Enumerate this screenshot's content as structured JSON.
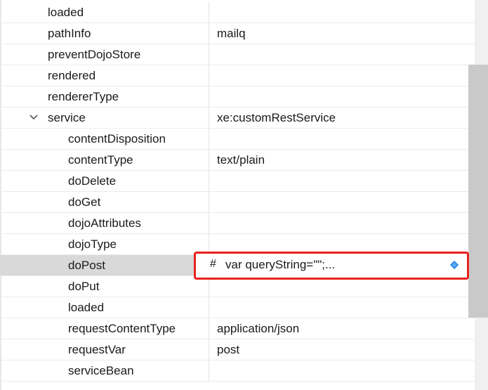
{
  "properties": [
    {
      "name": "loaded",
      "value": ""
    },
    {
      "name": "pathInfo",
      "value": "mailq"
    },
    {
      "name": "preventDojoStore",
      "value": ""
    },
    {
      "name": "rendered",
      "value": ""
    },
    {
      "name": "rendererType",
      "value": ""
    },
    {
      "name": "service",
      "value": "xe:customRestService",
      "expanded": true
    },
    {
      "name": "contentDisposition",
      "value": ""
    },
    {
      "name": "contentType",
      "value": "text/plain"
    },
    {
      "name": "doDelete",
      "value": ""
    },
    {
      "name": "doGet",
      "value": ""
    },
    {
      "name": "dojoAttributes",
      "value": ""
    },
    {
      "name": "dojoType",
      "value": ""
    },
    {
      "name": "doPost",
      "value": "",
      "selected": true
    },
    {
      "name": "doPut",
      "value": ""
    },
    {
      "name": "loaded",
      "value": ""
    },
    {
      "name": "requestContentType",
      "value": "application/json"
    },
    {
      "name": "requestVar",
      "value": "post"
    },
    {
      "name": "serviceBean",
      "value": ""
    }
  ],
  "editor": {
    "prefix": "#",
    "value": "var queryString=\"\";..."
  },
  "colors": {
    "highlight_border": "#e8211d",
    "selected_row": "#d9d9d9",
    "diamond": "#1f7fe0"
  }
}
